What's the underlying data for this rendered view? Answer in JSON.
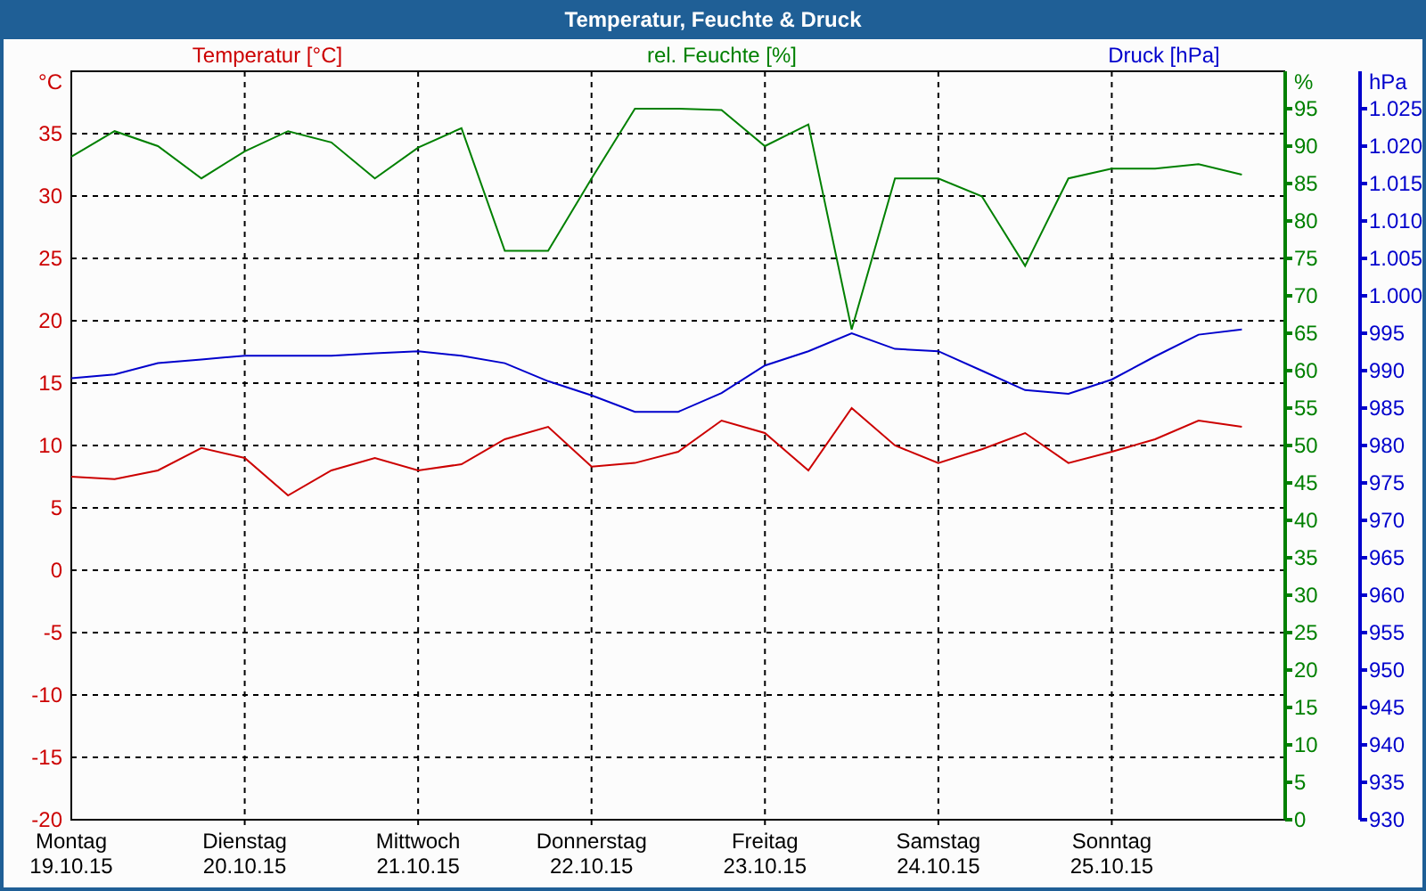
{
  "window": {
    "title": "Temperatur, Feuchte & Druck"
  },
  "chart": {
    "x_dates": [
      "19.10.15",
      "20.10.15",
      "21.10.15",
      "22.10.15",
      "23.10.15",
      "24.10.15",
      "25.10.15"
    ],
    "charts": [
      {
        "chart_data": {
          "type": "line",
          "ylabel": "°C",
          "grid": true,
          "categories": [
            "Montag",
            null,
            null,
            null,
            "Dienstag",
            null,
            null,
            null,
            "Mittwoch",
            null,
            null,
            null,
            "Donnerstag",
            null,
            null,
            null,
            "Freitag",
            null,
            null,
            null,
            "Samstag",
            null,
            null,
            null,
            "Sonntag",
            null,
            null,
            null,
            null
          ],
          "ylim": [
            -20,
            40
          ],
          "yticks": [
            -20,
            -15,
            -10,
            -5,
            0,
            5,
            10,
            15,
            20,
            25,
            30,
            35
          ],
          "series": [
            {
              "name": "Temperatur [°C]",
              "color": "#cc0000",
              "values": [
                7.5,
                7.3,
                8,
                9.8,
                9,
                6,
                8,
                9,
                8,
                8.5,
                10.5,
                11.5,
                8.3,
                8.6,
                9.5,
                12,
                11,
                8,
                13,
                10,
                8.6,
                9.7,
                11,
                8.6,
                9.5,
                10.5,
                12,
                11.5,
                null
              ]
            }
          ]
        }
      },
      {
        "chart_data": {
          "type": "line",
          "ylabel": "%",
          "categories": [
            null,
            null,
            null,
            null,
            null,
            null,
            null,
            null,
            null,
            null,
            null,
            null,
            null,
            null,
            null,
            null,
            null,
            null,
            null,
            null,
            null,
            null,
            null,
            null,
            null,
            null,
            null,
            null,
            null
          ],
          "ylim": [
            0,
            100
          ],
          "yticks": [
            0,
            5,
            10,
            15,
            20,
            25,
            30,
            35,
            40,
            45,
            50,
            55,
            60,
            65,
            70,
            75,
            80,
            85,
            90,
            95
          ],
          "series": [
            {
              "name": "rel. Feuchte [%]",
              "color": "#008000",
              "values": [
                88.6,
                92,
                90,
                85.7,
                89.3,
                92,
                90.5,
                85.7,
                89.8,
                92.4,
                76,
                76,
                85.7,
                95,
                95,
                94.8,
                90,
                92.9,
                65.5,
                85.7,
                85.7,
                83.3,
                74,
                85.7,
                87,
                87,
                87.6,
                86.2,
                null
              ]
            }
          ]
        }
      },
      {
        "chart_data": {
          "type": "line",
          "ylabel": "hPa",
          "categories": [
            null,
            null,
            null,
            null,
            null,
            null,
            null,
            null,
            null,
            null,
            null,
            null,
            null,
            null,
            null,
            null,
            null,
            null,
            null,
            null,
            null,
            null,
            null,
            null,
            null,
            null,
            null,
            null,
            null
          ],
          "ylim": [
            930,
            1030
          ],
          "yticks": [
            930,
            935,
            940,
            945,
            950,
            955,
            960,
            965,
            970,
            975,
            980,
            985,
            990,
            995,
            {
              "value": 1000,
              "label": "1.000"
            },
            {
              "value": 1005,
              "label": "1.005"
            },
            {
              "value": 1010,
              "label": "1.010"
            },
            {
              "value": 1015,
              "label": "1.015"
            },
            {
              "value": 1020,
              "label": "1.020"
            },
            {
              "value": 1025,
              "label": "1.025"
            }
          ],
          "series": [
            {
              "name": "Druck [hPa]",
              "color": "#0000cc",
              "values": [
                989,
                989.5,
                991,
                991.5,
                992,
                992,
                992,
                992.3,
                992.6,
                992,
                991,
                988.6,
                986.7,
                984.5,
                984.5,
                987,
                990.7,
                992.6,
                995,
                992.9,
                992.6,
                990,
                987.4,
                986.9,
                988.8,
                991.9,
                994.8,
                995.5,
                null
              ]
            }
          ]
        }
      }
    ]
  }
}
